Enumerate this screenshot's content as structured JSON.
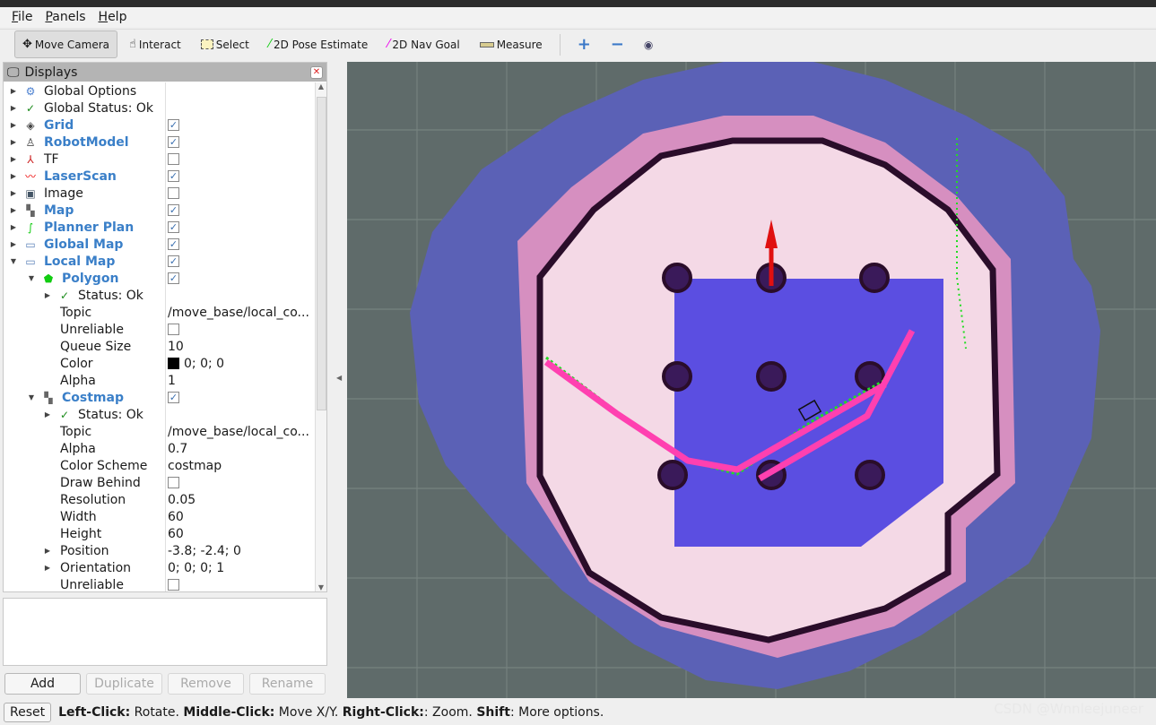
{
  "menu": [
    "File",
    "Panels",
    "Help"
  ],
  "toolbar": {
    "tools": [
      {
        "label": "Move Camera",
        "icon": "move-camera-icon",
        "active": true
      },
      {
        "label": "Interact",
        "icon": "hand-icon"
      },
      {
        "label": "Select",
        "icon": "select-icon"
      },
      {
        "label": "2D Pose Estimate",
        "icon": "green-arrow-icon"
      },
      {
        "label": "2D Nav Goal",
        "icon": "magenta-arrow-icon"
      },
      {
        "label": "Measure",
        "icon": "ruler-icon"
      }
    ]
  },
  "displays": {
    "title": "Displays",
    "rows": [
      {
        "name": "Global Options",
        "level": 0,
        "icon": "gear-icon",
        "expand": "collapsed"
      },
      {
        "name": "Global Status: Ok",
        "level": 0,
        "icon": "check-icon",
        "expand": "collapsed"
      },
      {
        "name": "Grid",
        "level": 0,
        "icon": "grid-icon",
        "expand": "collapsed",
        "bold": true,
        "checked": true
      },
      {
        "name": "RobotModel",
        "level": 0,
        "icon": "robot-icon",
        "expand": "collapsed",
        "bold": true,
        "checked": true
      },
      {
        "name": "TF",
        "level": 0,
        "icon": "axes-icon",
        "expand": "collapsed",
        "checked": false
      },
      {
        "name": "LaserScan",
        "level": 0,
        "icon": "laser-icon",
        "expand": "collapsed",
        "bold": true,
        "checked": true
      },
      {
        "name": "Image",
        "level": 0,
        "icon": "image-icon",
        "expand": "collapsed",
        "checked": false
      },
      {
        "name": "Map",
        "level": 0,
        "icon": "map-icon",
        "expand": "collapsed",
        "bold": true,
        "checked": true
      },
      {
        "name": "Planner Plan",
        "level": 0,
        "icon": "path-icon",
        "expand": "collapsed",
        "bold": true,
        "checked": true
      },
      {
        "name": "Global Map",
        "level": 0,
        "icon": "folder-icon",
        "expand": "collapsed",
        "bold": true,
        "checked": true
      },
      {
        "name": "Local Map",
        "level": 0,
        "icon": "folder-icon",
        "expand": "expanded",
        "bold": true,
        "checked": true
      },
      {
        "name": "Polygon",
        "level": 1,
        "icon": "polygon-icon",
        "expand": "expanded",
        "bold": true,
        "checked": true
      },
      {
        "name": "Status: Ok",
        "level": 2,
        "icon": "check-icon",
        "expand": "collapsed"
      },
      {
        "name": "Topic",
        "level": 2,
        "value": "/move_base/local_co..."
      },
      {
        "name": "Unreliable",
        "level": 2,
        "checked": false
      },
      {
        "name": "Queue Size",
        "level": 2,
        "value": "10"
      },
      {
        "name": "Color",
        "level": 2,
        "value": "0; 0; 0",
        "swatch": "#000000"
      },
      {
        "name": "Alpha",
        "level": 2,
        "value": "1"
      },
      {
        "name": "Costmap",
        "level": 1,
        "icon": "map-icon",
        "expand": "expanded",
        "bold": true,
        "checked": true
      },
      {
        "name": "Status: Ok",
        "level": 2,
        "icon": "check-icon",
        "expand": "collapsed"
      },
      {
        "name": "Topic",
        "level": 2,
        "value": "/move_base/local_co..."
      },
      {
        "name": "Alpha",
        "level": 2,
        "value": "0.7"
      },
      {
        "name": "Color Scheme",
        "level": 2,
        "value": "costmap"
      },
      {
        "name": "Draw Behind",
        "level": 2,
        "checked": false
      },
      {
        "name": "Resolution",
        "level": 2,
        "value": "0.05"
      },
      {
        "name": "Width",
        "level": 2,
        "value": "60"
      },
      {
        "name": "Height",
        "level": 2,
        "value": "60"
      },
      {
        "name": "Position",
        "level": 2,
        "value": "-3.8; -2.4; 0",
        "expand": "collapsed"
      },
      {
        "name": "Orientation",
        "level": 2,
        "value": "0; 0; 0; 1",
        "expand": "collapsed"
      },
      {
        "name": "Unreliable",
        "level": 2,
        "checked": false
      }
    ],
    "buttons": {
      "add": "Add",
      "duplicate": "Duplicate",
      "remove": "Remove",
      "rename": "Rename"
    }
  },
  "status": {
    "reset": "Reset",
    "hint_parts": [
      {
        "b": "Left-Click:",
        "t": " Rotate. "
      },
      {
        "b": "Middle-Click:",
        "t": " Move X/Y. "
      },
      {
        "b": "Right-Click:",
        "t": ": Zoom. "
      },
      {
        "b": "Shift",
        "t": ": More options."
      }
    ]
  },
  "watermark": "CSDN @Wnnleejuneer",
  "colors": {
    "background": "#5f6b6a",
    "costmap_blue": "#5a5fd0",
    "path": "#22dd22",
    "arrow": "#e01010"
  }
}
